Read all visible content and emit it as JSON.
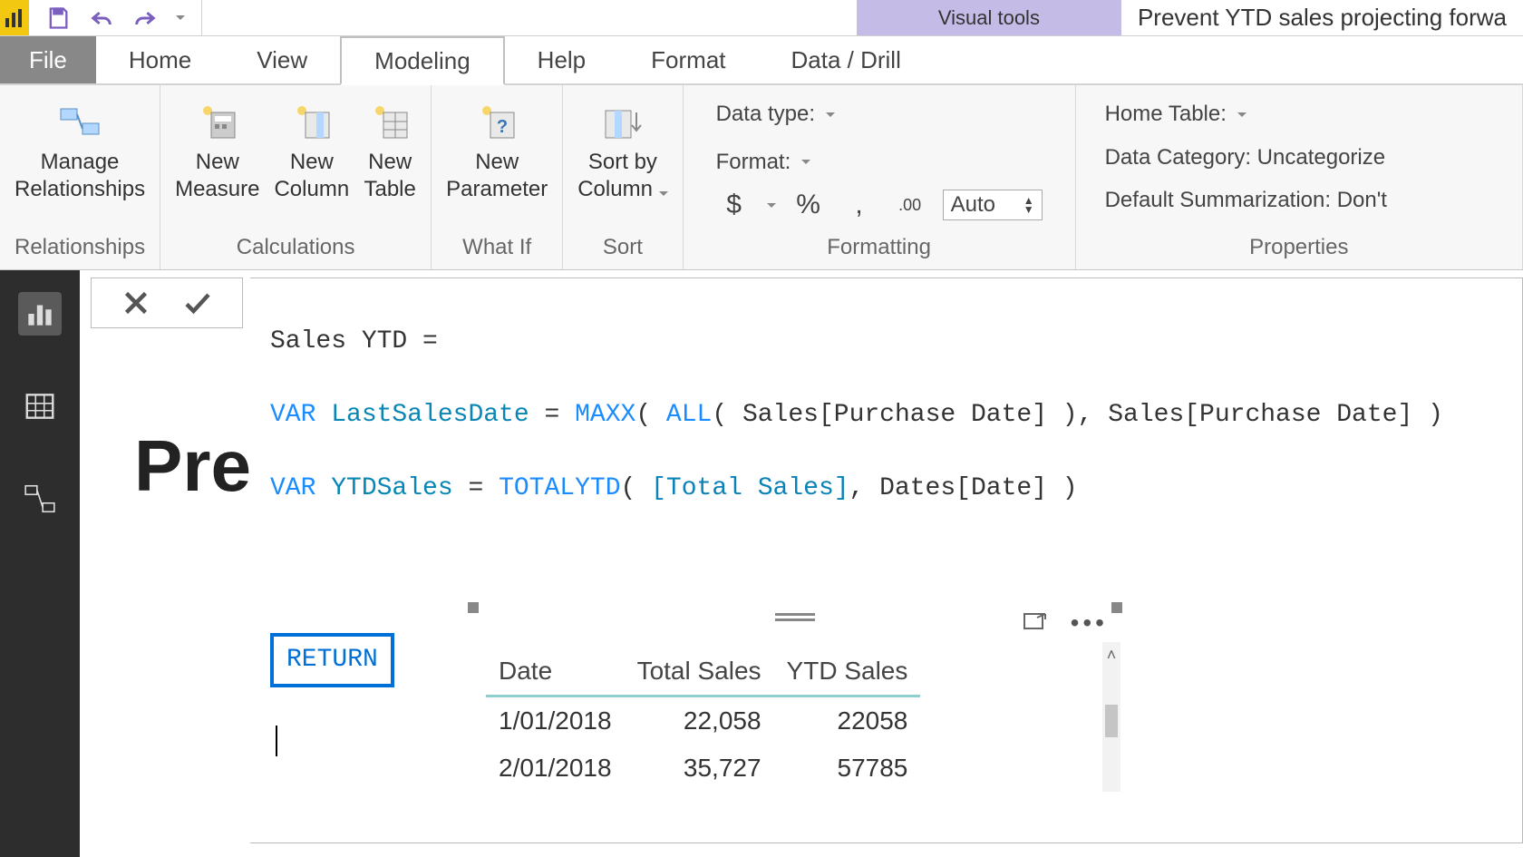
{
  "titlebar": {
    "visual_tools_label": "Visual tools",
    "document_title": "Prevent YTD sales projecting forwa"
  },
  "tabs": {
    "file": "File",
    "home": "Home",
    "view": "View",
    "modeling": "Modeling",
    "help": "Help",
    "format": "Format",
    "data_drill": "Data / Drill"
  },
  "ribbon": {
    "relationships": {
      "manage_relationships_line1": "Manage",
      "manage_relationships_line2": "Relationships",
      "group_label": "Relationships"
    },
    "calculations": {
      "new_measure_line1": "New",
      "new_measure_line2": "Measure",
      "new_column_line1": "New",
      "new_column_line2": "Column",
      "new_table_line1": "New",
      "new_table_line2": "Table",
      "group_label": "Calculations"
    },
    "whatif": {
      "new_parameter_line1": "New",
      "new_parameter_line2": "Parameter",
      "group_label": "What If"
    },
    "sort": {
      "sort_by_column_line1": "Sort by",
      "sort_by_column_line2": "Column",
      "group_label": "Sort"
    },
    "formatting": {
      "data_type_label": "Data type:",
      "format_label": "Format:",
      "dollar": "$",
      "percent": "%",
      "comma": ",",
      "decimals_icon": ".00",
      "auto_label": "Auto",
      "group_label": "Formatting"
    },
    "properties": {
      "home_table_label": "Home Table:",
      "data_category_label": "Data Category: Uncategorize",
      "default_summarization_label": "Default Summarization: Don't",
      "group_label": "Properties"
    }
  },
  "formula": {
    "line1_name": "Sales YTD =",
    "line2_var": "VAR",
    "line2_ident": " LastSalesDate",
    "line2_eq": " = ",
    "line2_maxx": "MAXX",
    "line2_open": "( ",
    "line2_all": "ALL",
    "line2_mid": "( Sales[Purchase Date] ), Sales[Purchase Date] )",
    "line3_var": "VAR",
    "line3_ident": " YTDSales",
    "line3_eq": " = ",
    "line3_totalytd": "TOTALYTD",
    "line3_open": "( ",
    "line3_totalSales": "[Total Sales]",
    "line3_tail": ", Dates[Date] )",
    "intellisense": "RETURN"
  },
  "report": {
    "background_text": "Prev"
  },
  "table": {
    "headers": {
      "c1": "Date",
      "c2": "Total Sales",
      "c3": "YTD Sales"
    },
    "rows": [
      {
        "date": "1/01/2018",
        "total": "22,058",
        "ytd": "22058"
      },
      {
        "date": "2/01/2018",
        "total": "35,727",
        "ytd": "57785"
      }
    ]
  }
}
